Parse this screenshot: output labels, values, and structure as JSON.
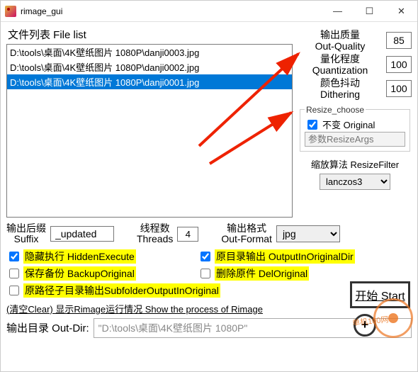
{
  "window": {
    "title": "rimage_gui"
  },
  "filelist": {
    "label": "文件列表 File list",
    "items": [
      {
        "path": "D:\\tools\\桌面\\4K壁纸图片 1080P\\danji0003.jpg",
        "selected": false
      },
      {
        "path": "D:\\tools\\桌面\\4K壁纸图片 1080P\\danji0002.jpg",
        "selected": false
      },
      {
        "path": "D:\\tools\\桌面\\4K壁纸图片 1080P\\danji0001.jpg",
        "selected": true
      }
    ]
  },
  "params": {
    "quality": {
      "label_cn": "输出质量",
      "label_en": "Out-Quality",
      "value": "85"
    },
    "quantization": {
      "label_cn": "量化程度",
      "label_en": "Quantization",
      "value": "100"
    },
    "dithering": {
      "label_cn": "颜色抖动",
      "label_en": "Dithering",
      "value": "100"
    }
  },
  "resize": {
    "legend": "Resize_choose",
    "original_label": "不变 Original",
    "original_checked": true,
    "args_placeholder": "参数ResizeArgs",
    "filter_label": "缩放算法 ResizeFilter",
    "filter_value": "lanczos3"
  },
  "mid": {
    "suffix_label_cn": "输出后缀",
    "suffix_label_en": "Suffix",
    "suffix_value": "_updated",
    "threads_label_cn": "线程数",
    "threads_label_en": "Threads",
    "threads_value": "4",
    "format_label_cn": "输出格式",
    "format_label_en": "Out-Format",
    "format_value": "jpg"
  },
  "options": {
    "hidden": {
      "label": "隐藏执行 HiddenExecute",
      "checked": true
    },
    "origdir": {
      "label": "原目录输出 OutputInOriginalDir",
      "checked": true
    },
    "backup": {
      "label": "保存备份 BackupOriginal",
      "checked": false
    },
    "delete": {
      "label": "删除原件 DelOriginal",
      "checked": false
    },
    "subfolder": {
      "label": "原路径子目录输出SubfolderOutputInOriginal",
      "checked": false
    }
  },
  "clear_label": "(清空Clear) 显示Rimage运行情况 Show the process of Rimage",
  "outdir": {
    "label": "输出目录 Out-Dir:",
    "value": "\"D:\\tools\\桌面\\4K壁纸图片 1080P\""
  },
  "start_label": "开始 Start",
  "plus_label": "+",
  "watermark_text": "单机100网"
}
